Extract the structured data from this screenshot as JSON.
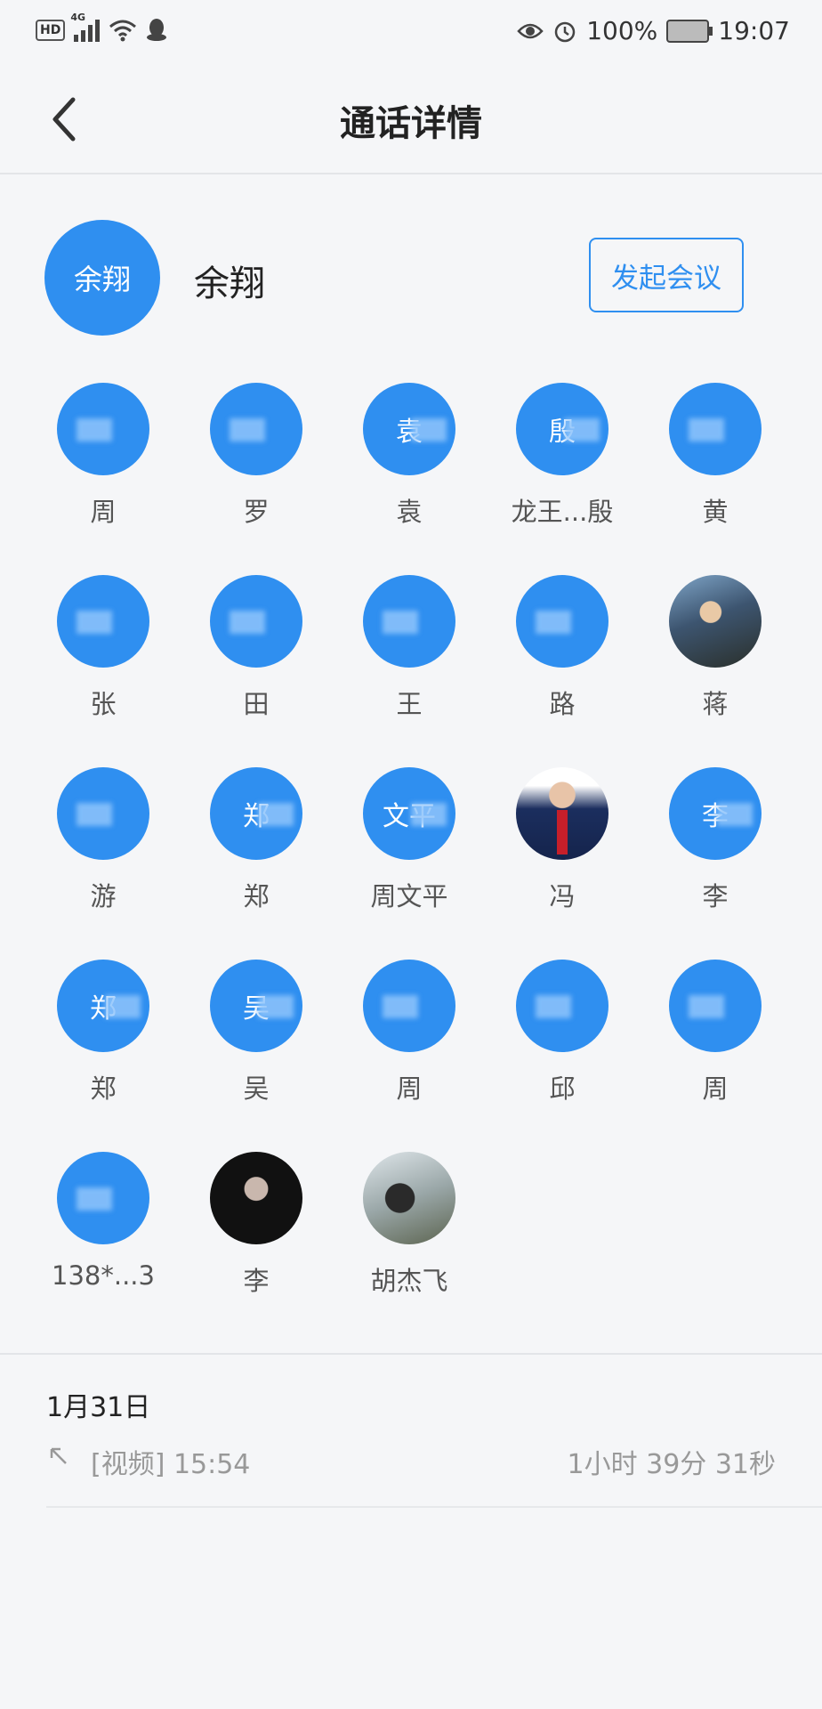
{
  "status_bar": {
    "left_icons": [
      "hd-icon",
      "signal-4g-icon",
      "wifi-icon",
      "qq-icon"
    ],
    "network_label": "4G",
    "hd_label": "HD",
    "battery_percent": "100%",
    "time": "19:07"
  },
  "header": {
    "title": "通话详情",
    "back_icon": "back-chevron-icon"
  },
  "caller": {
    "avatar_text": "余翔",
    "name": "余翔",
    "start_meeting_label": "发起会议"
  },
  "participants": [
    {
      "avatar_text": "",
      "name": "周"
    },
    {
      "avatar_text": "",
      "name": "罗"
    },
    {
      "avatar_text": "袁",
      "name": "袁"
    },
    {
      "avatar_text": "殷",
      "name": "龙王...殷"
    },
    {
      "avatar_text": "",
      "name": "黄"
    },
    {
      "avatar_text": "",
      "name": "张"
    },
    {
      "avatar_text": "",
      "name": "田"
    },
    {
      "avatar_text": "",
      "name": "王"
    },
    {
      "avatar_text": "",
      "name": "路"
    },
    {
      "avatar_text": "",
      "name": "蒋",
      "photo": "photo1"
    },
    {
      "avatar_text": "",
      "name": "游"
    },
    {
      "avatar_text": "郑",
      "name": "郑"
    },
    {
      "avatar_text": "文平",
      "name": "周文平"
    },
    {
      "avatar_text": "",
      "name": "冯",
      "photo": "photo2"
    },
    {
      "avatar_text": "李",
      "name": "李"
    },
    {
      "avatar_text": "郑",
      "name": "郑"
    },
    {
      "avatar_text": "吴",
      "name": "吴"
    },
    {
      "avatar_text": "",
      "name": "周"
    },
    {
      "avatar_text": "",
      "name": "邱"
    },
    {
      "avatar_text": "",
      "name": "周"
    },
    {
      "avatar_text": "",
      "name": "138*...3"
    },
    {
      "avatar_text": "",
      "name": "李",
      "photo": "photo3"
    },
    {
      "avatar_text": "",
      "name": "胡杰飞",
      "photo": "photo4"
    }
  ],
  "call_log": {
    "date": "1月31日",
    "direction_icon": "outgoing-arrow-icon",
    "type_time": "[视频]  15:54",
    "duration": "1小时 39分 31秒"
  },
  "colors": {
    "accent": "#2f8ff0",
    "background": "#f5f6f8",
    "muted_text": "#999999"
  }
}
